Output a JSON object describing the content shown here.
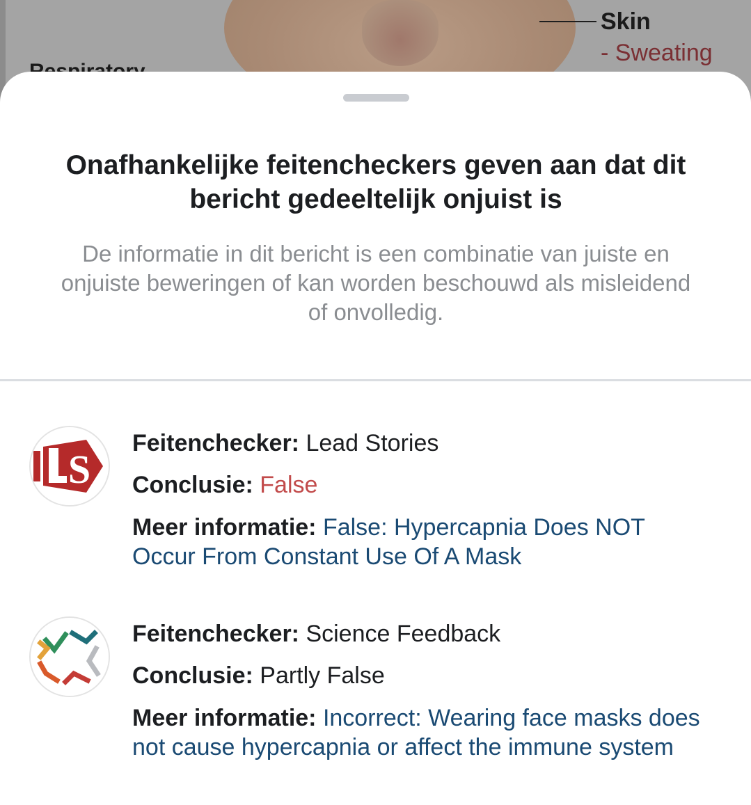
{
  "background": {
    "skin_label": "Skin",
    "sweating_label": "- Sweating",
    "respiratory_label": "Respiratory"
  },
  "sheet": {
    "title": "Onafhankelijke feitencheckers geven aan dat dit bericht gedeeltelijk onjuist is",
    "subtitle": "De informatie in dit bericht is een combinatie van juiste en onjuiste beweringen of kan worden beschouwd als misleidend of onvolledig."
  },
  "labels": {
    "factchecker": "Feitenchecker:",
    "conclusion": "Conclusie:",
    "more_info": "Meer informatie:"
  },
  "factchecks": [
    {
      "logo_icon": "lead-stories-logo-icon",
      "factchecker": "Lead Stories",
      "conclusion": "False",
      "more_info": "False: Hypercapnia Does NOT Occur From Constant Use Of A Mask"
    },
    {
      "logo_icon": "science-feedback-logo-icon",
      "factchecker": "Science Feedback",
      "conclusion": "Partly False",
      "more_info": "Incorrect: Wearing face masks does not cause hypercapnia or affect the immune system"
    }
  ],
  "colors": {
    "sheet_background": "#ffffff",
    "title_text": "#1c1e21",
    "subtitle_text": "#8a8d91",
    "false_conclusion": "#c24b4b",
    "link": "#1a4a73",
    "lead_stories_red": "#b52a2a"
  }
}
